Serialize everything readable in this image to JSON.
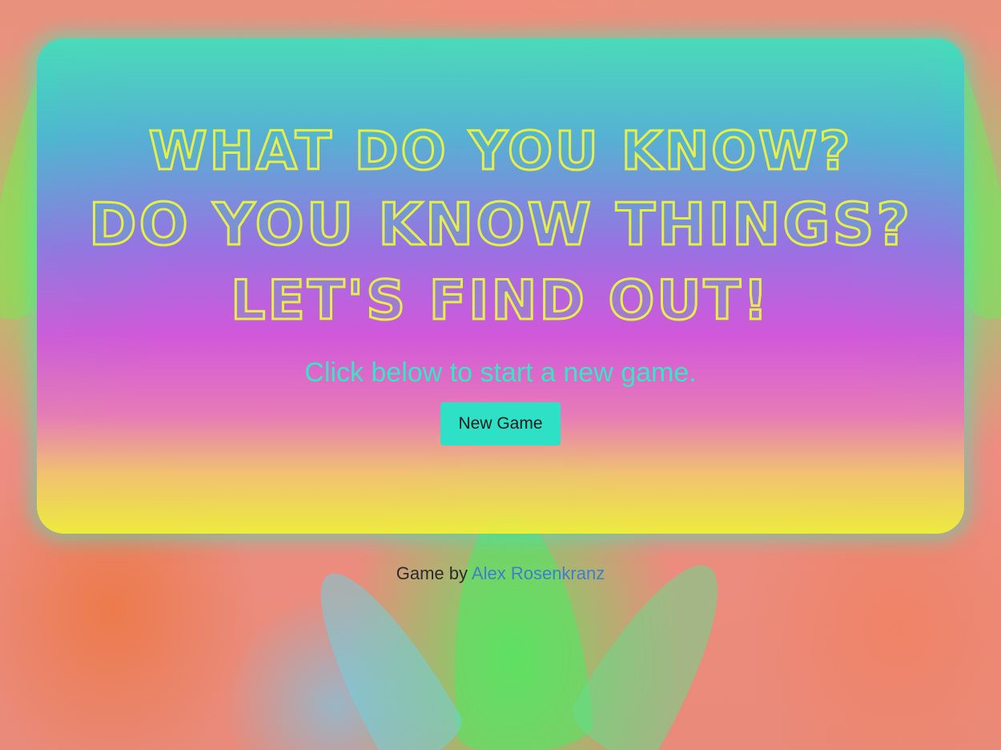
{
  "hero": {
    "line1": "What do you know?",
    "line2": "Do you know things?",
    "line3": "Let's find out!",
    "subtitle": "Click below to start a new game.",
    "new_game_label": "New Game"
  },
  "footer": {
    "prefix": "Game by",
    "author_link": "Alex Rosenkranz"
  },
  "colors": {
    "headline": "#e6ee4a",
    "subtitle": "#36e6c4",
    "button": "#2ee0c6",
    "link": "#3b7fd0"
  }
}
